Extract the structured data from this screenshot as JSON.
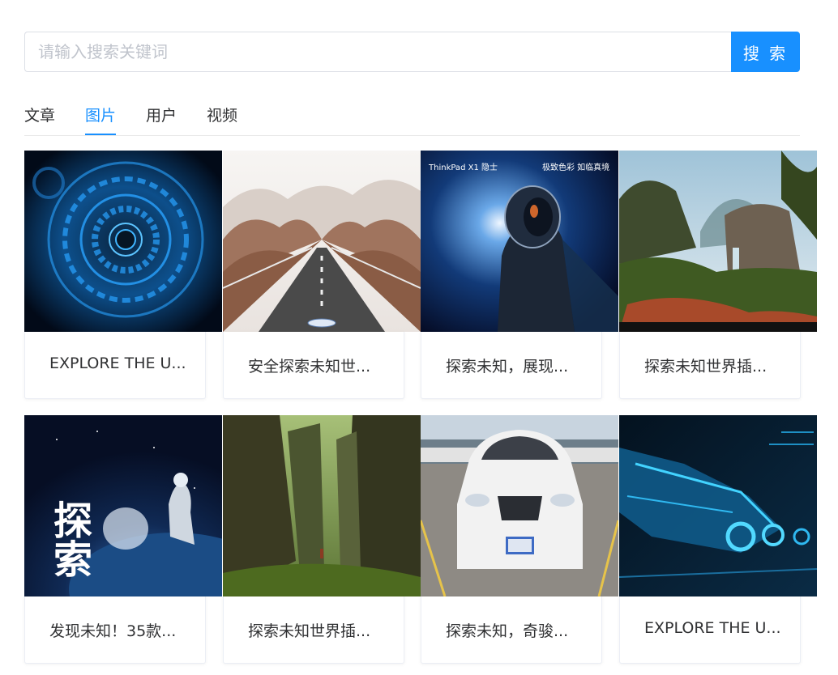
{
  "search": {
    "placeholder": "请输入搜索关键词",
    "value": "",
    "button_label": "搜 索",
    "accent_color": "#1890ff"
  },
  "tabs": [
    {
      "label": "文章",
      "active": false
    },
    {
      "label": "图片",
      "active": true
    },
    {
      "label": "用户",
      "active": false
    },
    {
      "label": "视频",
      "active": false
    }
  ],
  "results": [
    {
      "caption": "EXPLORE THE U...",
      "image": "blue-tech-circle-image"
    },
    {
      "caption": "安全探索未知世...",
      "image": "misty-road-image"
    },
    {
      "caption": "探索未知，展现...",
      "image": "astronaut-thinkpad-image",
      "image_text": {
        "left": "ThinkPad X1 隐士",
        "right": "极致色彩 如临真境"
      }
    },
    {
      "caption": "探索未知世界插...",
      "image": "jungle-waterfall-image"
    },
    {
      "caption": "发现未知！35款...",
      "image": "astronaut-planet-poster-image",
      "image_text": {
        "big": "探索"
      }
    },
    {
      "caption": "探索未知世界插...",
      "image": "forest-canyon-image"
    },
    {
      "caption": "探索未知，奇骏...",
      "image": "white-suv-image"
    },
    {
      "caption": "EXPLORE THE U...",
      "image": "blue-spaceship-image"
    }
  ]
}
